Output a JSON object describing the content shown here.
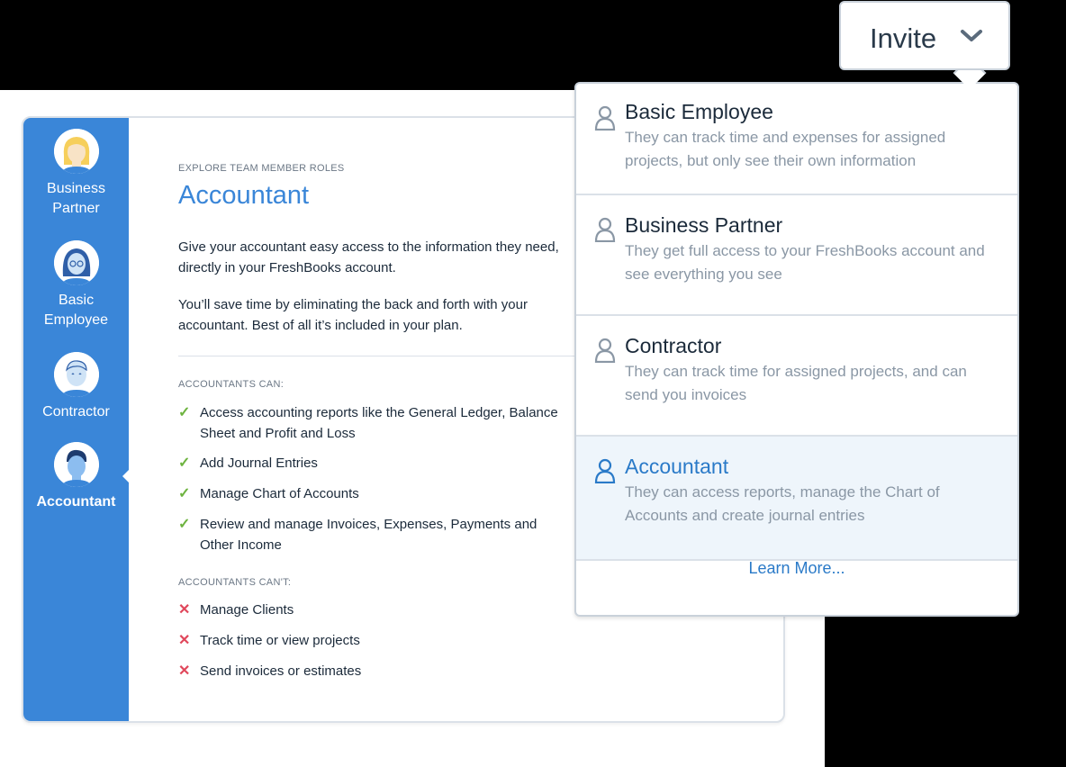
{
  "sidebar": {
    "roles": [
      {
        "label_line1": "Business",
        "label_line2": "Partner"
      },
      {
        "label_line1": "Basic",
        "label_line2": "Employee"
      },
      {
        "label_line1": "Contractor",
        "label_line2": ""
      },
      {
        "label_line1": "Accountant",
        "label_line2": "",
        "active": true
      }
    ]
  },
  "main": {
    "eyebrow": "EXPLORE TEAM MEMBER ROLES",
    "title": "Accountant",
    "para1": "Give your accountant easy access to the information they need, directly in your FreshBooks account.",
    "para2": "You’ll save time by eliminating the back and forth with your accountant. Best of all it’s included in your plan.",
    "can_label": "ACCOUNTANTS CAN:",
    "can": [
      "Access accounting reports like the General Ledger, Balance Sheet and Profit and Loss",
      "Add Journal Entries",
      "Manage Chart of Accounts",
      "Review and manage Invoices, Expenses, Payments and Other Income"
    ],
    "cant_label": "ACCOUNTANTS CAN'T:",
    "cant": [
      "Manage Clients",
      "Track time or view projects",
      "Send invoices or estimates"
    ]
  },
  "invite": {
    "label": "Invite"
  },
  "dropdown": {
    "options": [
      {
        "name": "Basic Employee",
        "desc": "They can track time and expenses for assigned projects, but only see their own information"
      },
      {
        "name": "Business Partner",
        "desc": "They get full access to your FreshBooks account and see everything you see"
      },
      {
        "name": "Contractor",
        "desc": "They can track time for assigned projects, and can send you invoices"
      },
      {
        "name": "Accountant",
        "desc": "They can access reports, manage the Chart of Accounts and create journal entries",
        "selected": true
      }
    ],
    "learn_more": "Learn More..."
  },
  "colors": {
    "accent": "#3a86d8",
    "check": "#6db33f",
    "cross": "#e0475b"
  }
}
